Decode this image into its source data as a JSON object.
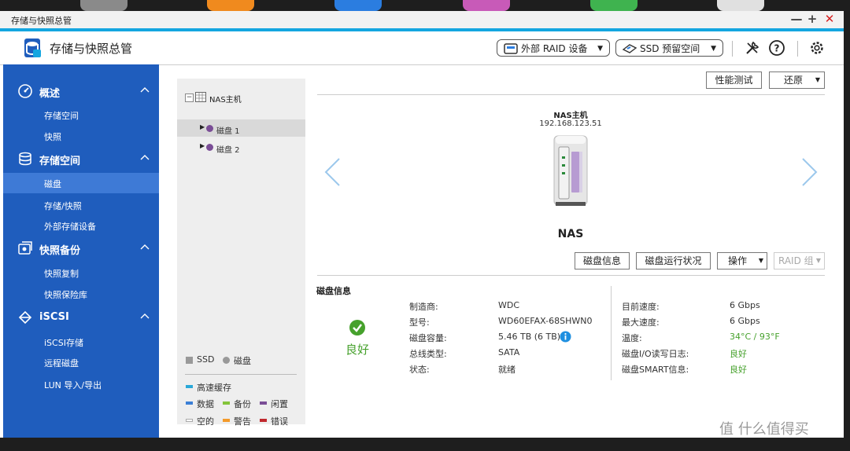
{
  "window": {
    "title": "存储与快照总管",
    "controls": {
      "minimize": "—",
      "maximize": "+",
      "close": "✕"
    }
  },
  "header": {
    "app_title": "存储与快照总管",
    "external_raid_button": "外部 RAID 设备",
    "ssd_overprovision_button": "SSD 预留空间"
  },
  "sidebar": {
    "sections": [
      {
        "label": "概述",
        "icon": "gauge-icon",
        "items": [
          "存储空间",
          "快照"
        ]
      },
      {
        "label": "存储空间",
        "icon": "database-icon",
        "items": [
          "磁盘",
          "存储/快照",
          "外部存储设备"
        ]
      },
      {
        "label": "快照备份",
        "icon": "snapshot-backup-icon",
        "items": [
          "快照复制",
          "快照保险库"
        ]
      },
      {
        "label": "iSCSI",
        "icon": "iscsi-icon",
        "items": [
          "iSCSI存储",
          "远程磁盘",
          "LUN 导入/导出"
        ]
      }
    ],
    "active_item": "磁盘"
  },
  "tree": {
    "root": "NAS主机",
    "disks": [
      "磁盘 1",
      "磁盘 2"
    ]
  },
  "legend": {
    "types": [
      "SSD",
      "磁盘"
    ],
    "cache": "高速缓存",
    "rows": [
      [
        "数据",
        "备份",
        "闲置"
      ],
      [
        "空的",
        "警告",
        "错误"
      ]
    ],
    "colors": {
      "cache": "#2aa8d8",
      "data": "#3b7fd6",
      "backup": "#84c43a",
      "idle": "#7a4d96",
      "empty": "#ffffff",
      "warning": "#f39a2a",
      "error": "#c0282d",
      "disk_dot": "#7a4d96"
    }
  },
  "toolbar": {
    "benchmark": "性能测试",
    "restore": "还原"
  },
  "device": {
    "name": "NAS主机",
    "ip": "192.168.123.51",
    "label": "NAS"
  },
  "actions": {
    "disk_info": "磁盘信息",
    "disk_health": "磁盘运行状况",
    "operate": "操作",
    "raid_group": "RAID 组"
  },
  "disk_info": {
    "section_title": "磁盘信息",
    "status_text": "良好",
    "left": [
      {
        "label": "制造商:",
        "value": "WDC"
      },
      {
        "label": "型号:",
        "value": "WD60EFAX-68SHWN0"
      },
      {
        "label": "磁盘容量:",
        "value": "5.46 TB (6 TB)"
      },
      {
        "label": "总线类型:",
        "value": "SATA"
      },
      {
        "label": "状态:",
        "value": "就绪"
      }
    ],
    "right": [
      {
        "label": "目前速度:",
        "value": "6 Gbps"
      },
      {
        "label": "最大速度:",
        "value": "6 Gbps"
      },
      {
        "label": "温度:",
        "value": "34°C / 93°F"
      },
      {
        "label": "磁盘I/O读写日志:",
        "value": "良好"
      },
      {
        "label": "磁盘SMART信息:",
        "value": "良好"
      }
    ]
  },
  "watermark": "值 什么值得买"
}
